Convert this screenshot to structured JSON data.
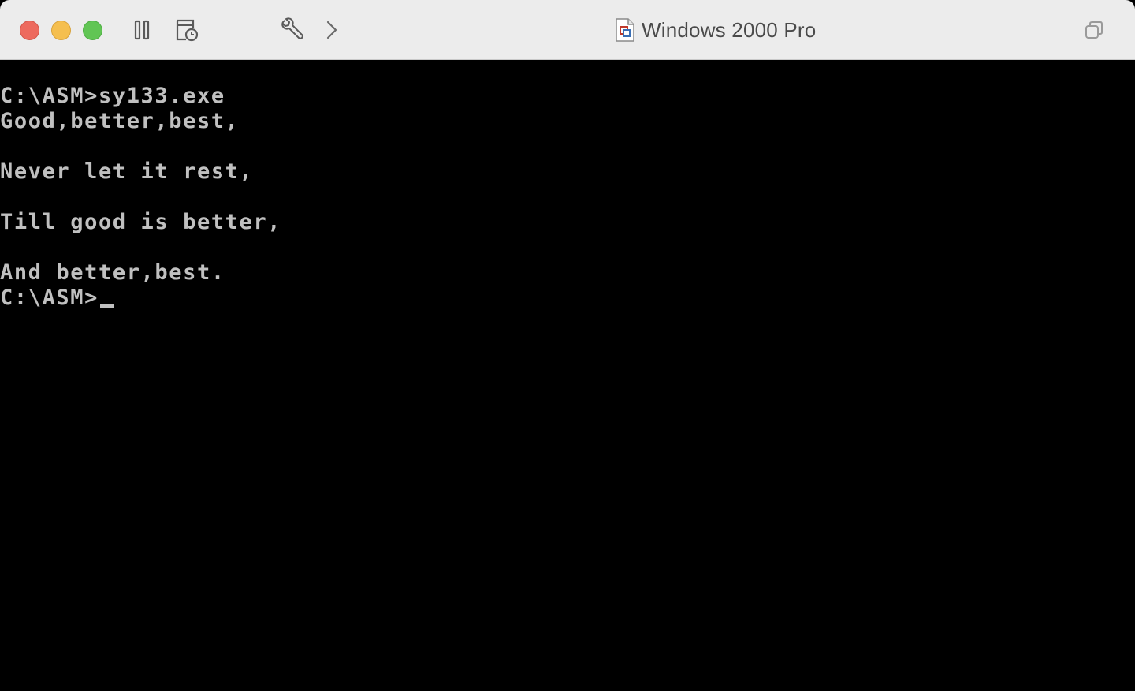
{
  "window": {
    "title": "Windows 2000 Pro"
  },
  "toolbar": {
    "icons": [
      "pause-icon",
      "snapshot-icon",
      "settings-wrench-icon",
      "forward-chevron-icon",
      "window-copy-icon"
    ]
  },
  "colors": {
    "console_bg": "#000000",
    "console_text": "#c0c0c0",
    "titlebar_bg": "#ececec"
  },
  "console": {
    "lines": [
      "C:\\ASM>sy133.exe",
      "Good,better,best,",
      "",
      "Never let it rest,",
      "",
      "Till good is better,",
      "",
      "And better,best.",
      "C:\\ASM>"
    ]
  }
}
